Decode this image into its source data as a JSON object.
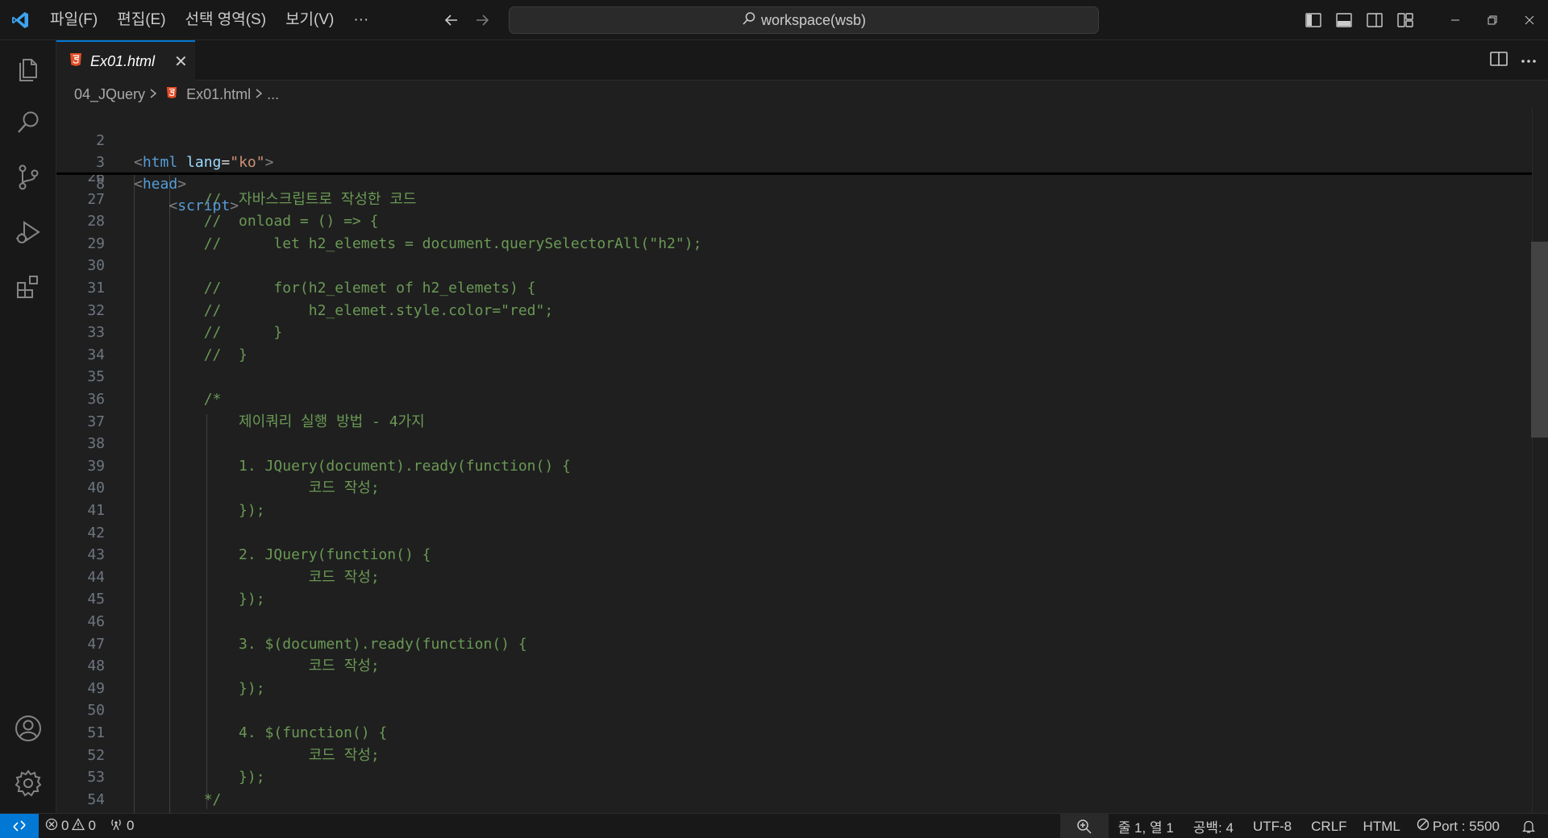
{
  "titlebar": {
    "menus": [
      "파일(F)",
      "편집(E)",
      "선택 영역(S)",
      "보기(V)",
      "···"
    ],
    "search_text": "workspace(wsb)"
  },
  "tab": {
    "label": "Ex01.html",
    "close": "✕"
  },
  "breadcrumb": {
    "folder": "04_JQuery",
    "file": "Ex01.html",
    "more": "..."
  },
  "sticky_lines": [
    {
      "n": "2",
      "code": "<html lang=\"ko\">"
    },
    {
      "n": "3",
      "code": "<head>"
    },
    {
      "n": "8",
      "code": "    <script>"
    }
  ],
  "lines": [
    {
      "n": "26",
      "code": ""
    },
    {
      "n": "27",
      "code": "        //  자바스크립트로 작성한 코드"
    },
    {
      "n": "28",
      "code": "        //  onload = () => {"
    },
    {
      "n": "29",
      "code": "        //      let h2_elemets = document.querySelectorAll(\"h2\");"
    },
    {
      "n": "30",
      "code": ""
    },
    {
      "n": "31",
      "code": "        //      for(h2_elemet of h2_elemets) {"
    },
    {
      "n": "32",
      "code": "        //          h2_elemet.style.color=\"red\";"
    },
    {
      "n": "33",
      "code": "        //      }"
    },
    {
      "n": "34",
      "code": "        //  }"
    },
    {
      "n": "35",
      "code": ""
    },
    {
      "n": "36",
      "code": "        /*"
    },
    {
      "n": "37",
      "code": "            제이쿼리 실행 방법 - 4가지"
    },
    {
      "n": "38",
      "code": ""
    },
    {
      "n": "39",
      "code": "            1. JQuery(document).ready(function() {"
    },
    {
      "n": "40",
      "code": "                    코드 작성;"
    },
    {
      "n": "41",
      "code": "            });"
    },
    {
      "n": "42",
      "code": ""
    },
    {
      "n": "43",
      "code": "            2. JQuery(function() {"
    },
    {
      "n": "44",
      "code": "                    코드 작성;"
    },
    {
      "n": "45",
      "code": "            });"
    },
    {
      "n": "46",
      "code": ""
    },
    {
      "n": "47",
      "code": "            3. $(document).ready(function() {"
    },
    {
      "n": "48",
      "code": "                    코드 작성;"
    },
    {
      "n": "49",
      "code": "            });"
    },
    {
      "n": "50",
      "code": ""
    },
    {
      "n": "51",
      "code": "            4. $(function() {"
    },
    {
      "n": "52",
      "code": "                    코드 작성;"
    },
    {
      "n": "53",
      "code": "            });"
    },
    {
      "n": "54",
      "code": "        */"
    }
  ],
  "status": {
    "errors": "0",
    "warnings": "0",
    "ports": "0",
    "position": "줄 1, 열 1",
    "spaces": "공백: 4",
    "encoding": "UTF-8",
    "eol": "CRLF",
    "language": "HTML",
    "port": "Port : 5500"
  },
  "colors": {
    "accent": "#0078d4",
    "comment": "#6a9955",
    "tag": "#569cd6",
    "attr": "#9cdcfe",
    "string": "#ce9178"
  },
  "icons": [
    "vscode-logo-icon",
    "explorer-icon",
    "search-icon",
    "source-control-icon",
    "run-debug-icon",
    "extensions-icon",
    "account-icon",
    "settings-gear-icon",
    "html5-icon",
    "split-editor-icon",
    "more-actions-icon",
    "bell-icon"
  ]
}
